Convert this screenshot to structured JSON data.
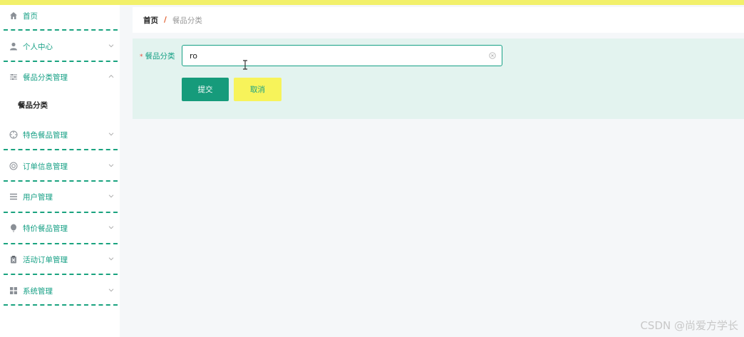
{
  "colors": {
    "accent": "#16a085",
    "top_bar": "#f2f06a",
    "submit_button": "#169b7b",
    "cancel_button": "#f7f35a",
    "panel_bg": "#e3f3ef",
    "breadcrumb_separator": "#e05b2a"
  },
  "sidebar": {
    "items": [
      {
        "label": "首页",
        "icon": "home-icon"
      },
      {
        "label": "个人中心",
        "icon": "user-icon"
      },
      {
        "label": "餐品分类管理",
        "icon": "sliders-icon",
        "expanded": true
      },
      {
        "label": "特色餐品管理",
        "icon": "crosshair-icon"
      },
      {
        "label": "订单信息管理",
        "icon": "lifebuoy-icon"
      },
      {
        "label": "用户管理",
        "icon": "list-icon"
      },
      {
        "label": "特价餐品管理",
        "icon": "balloon-icon"
      },
      {
        "label": "活动订单管理",
        "icon": "clipboard-icon"
      },
      {
        "label": "系统管理",
        "icon": "grid-icon"
      }
    ],
    "submenu": [
      {
        "label": "餐品分类",
        "active": true
      }
    ]
  },
  "breadcrumb": {
    "home": "首页",
    "separator": "/",
    "current": "餐品分类"
  },
  "form": {
    "field_label": "餐品分类",
    "required_mark": "*",
    "input_value": "ro",
    "submit_label": "提交",
    "cancel_label": "取消"
  },
  "watermark": "CSDN @尚爱方学长"
}
